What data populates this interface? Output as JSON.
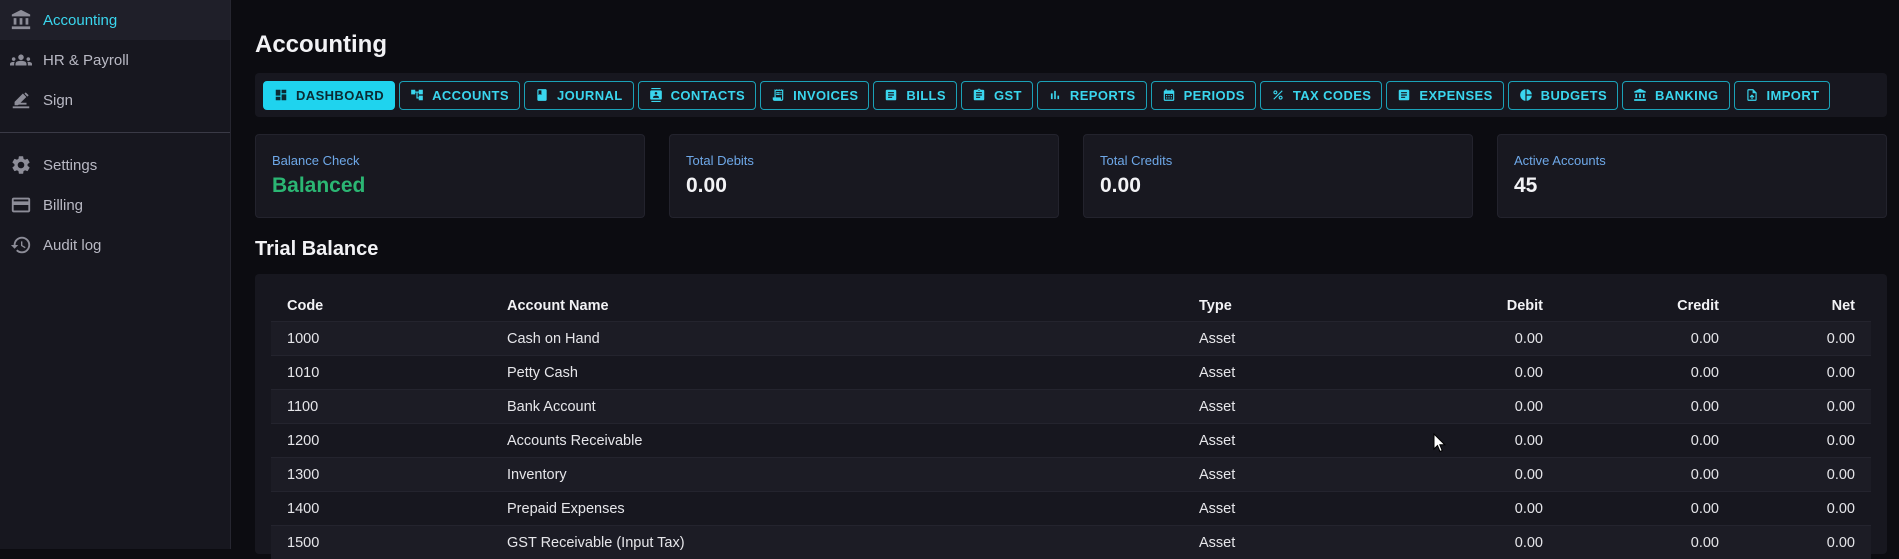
{
  "sidebar": {
    "items": [
      {
        "label": "Accounting",
        "icon": "bank-icon"
      },
      {
        "label": "HR & Payroll",
        "icon": "people-icon"
      },
      {
        "label": "Sign",
        "icon": "sign-icon"
      },
      {
        "label": "Settings",
        "icon": "gear-icon"
      },
      {
        "label": "Billing",
        "icon": "credit-card-icon"
      },
      {
        "label": "Audit log",
        "icon": "history-icon"
      }
    ]
  },
  "page": {
    "title": "Accounting"
  },
  "tabs": [
    {
      "label": "DASHBOARD",
      "icon": "dashboard-icon"
    },
    {
      "label": "ACCOUNTS",
      "icon": "account-tree-icon"
    },
    {
      "label": "JOURNAL",
      "icon": "book-icon"
    },
    {
      "label": "CONTACTS",
      "icon": "contact-card-icon"
    },
    {
      "label": "INVOICES",
      "icon": "receipt-icon"
    },
    {
      "label": "BILLS",
      "icon": "list-doc-icon"
    },
    {
      "label": "GST",
      "icon": "clipboard-icon"
    },
    {
      "label": "REPORTS",
      "icon": "bar-chart-icon"
    },
    {
      "label": "PERIODS",
      "icon": "calendar-icon"
    },
    {
      "label": "TAX CODES",
      "icon": "percent-icon"
    },
    {
      "label": "EXPENSES",
      "icon": "list-doc-icon"
    },
    {
      "label": "BUDGETS",
      "icon": "pie-chart-icon"
    },
    {
      "label": "BANKING",
      "icon": "bank-icon"
    },
    {
      "label": "IMPORT",
      "icon": "file-upload-icon"
    }
  ],
  "cards": [
    {
      "label": "Balance Check",
      "value": "Balanced"
    },
    {
      "label": "Total Debits",
      "value": "0.00"
    },
    {
      "label": "Total Credits",
      "value": "0.00"
    },
    {
      "label": "Active Accounts",
      "value": "45"
    }
  ],
  "trial_balance": {
    "title": "Trial Balance",
    "columns": [
      "Code",
      "Account Name",
      "Type",
      "Debit",
      "Credit",
      "Net"
    ],
    "rows": [
      [
        "1000",
        "Cash on Hand",
        "Asset",
        "0.00",
        "0.00",
        "0.00"
      ],
      [
        "1010",
        "Petty Cash",
        "Asset",
        "0.00",
        "0.00",
        "0.00"
      ],
      [
        "1100",
        "Bank Account",
        "Asset",
        "0.00",
        "0.00",
        "0.00"
      ],
      [
        "1200",
        "Accounts Receivable",
        "Asset",
        "0.00",
        "0.00",
        "0.00"
      ],
      [
        "1300",
        "Inventory",
        "Asset",
        "0.00",
        "0.00",
        "0.00"
      ],
      [
        "1400",
        "Prepaid Expenses",
        "Asset",
        "0.00",
        "0.00",
        "0.00"
      ],
      [
        "1500",
        "GST Receivable (Input Tax)",
        "Asset",
        "0.00",
        "0.00",
        "0.00"
      ]
    ]
  },
  "colors": {
    "accent": "#3ad6ee",
    "success": "#2bb673",
    "card_label": "#6ea8e8"
  }
}
